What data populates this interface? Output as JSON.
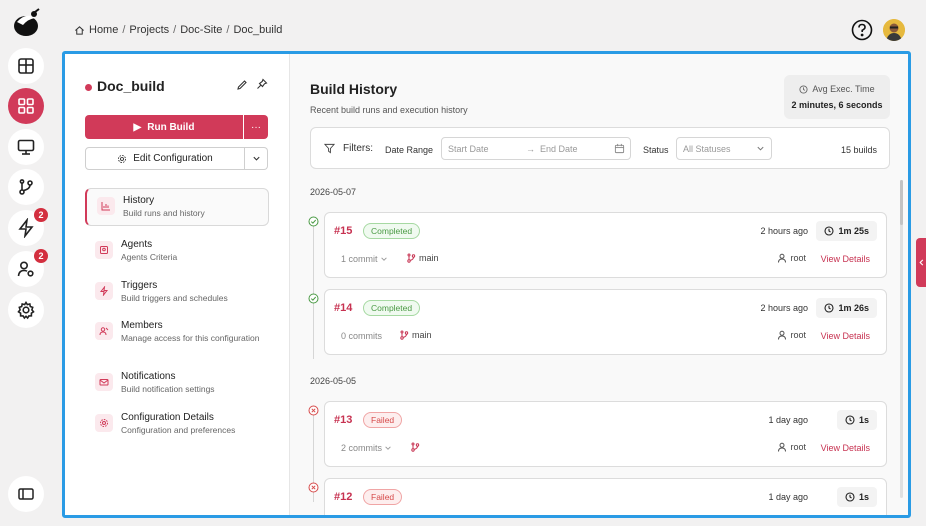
{
  "breadcrumb": {
    "items": [
      "Home",
      "Projects",
      "Doc-Site",
      "Doc_build"
    ],
    "sep": "/"
  },
  "rail": {
    "badges": {
      "builds": "2",
      "users": "2"
    }
  },
  "project": {
    "name": "Doc_build"
  },
  "actions": {
    "run_label": "Run Build",
    "more_label": "···",
    "edit_config_label": "Edit Configuration"
  },
  "nav": [
    {
      "title": "History",
      "sub": "Build runs and history"
    },
    {
      "title": "Agents",
      "sub": "Agents Criteria"
    },
    {
      "title": "Triggers",
      "sub": "Build triggers and schedules"
    },
    {
      "title": "Members",
      "sub": "Manage access for this configuration"
    },
    {
      "title": "Notifications",
      "sub": "Build notification settings"
    },
    {
      "title": "Configuration Details",
      "sub": "Configuration and preferences"
    }
  ],
  "history": {
    "title": "Build History",
    "subtitle": "Recent build runs and execution history",
    "avg_label": "Avg Exec. Time",
    "avg_value": "2 minutes, 6 seconds"
  },
  "filters": {
    "label": "Filters:",
    "date_range_label": "Date Range",
    "start_placeholder": "Start Date",
    "arrow": "→",
    "end_placeholder": "End Date",
    "status_label": "Status",
    "status_value": "All Statuses",
    "count": "15 builds"
  },
  "groups": [
    {
      "date": "2026-05-07"
    },
    {
      "date": "2026-05-05"
    }
  ],
  "builds": [
    {
      "num": "#15",
      "status": "Completed",
      "time": "2 hours ago",
      "duration": "1m 25s",
      "commits": "1 commit",
      "branch": "main",
      "user": "root",
      "details": "View Details"
    },
    {
      "num": "#14",
      "status": "Completed",
      "time": "2 hours ago",
      "duration": "1m 26s",
      "commits": "0 commits",
      "branch": "main",
      "user": "root",
      "details": "View Details"
    },
    {
      "num": "#13",
      "status": "Failed",
      "time": "1 day ago",
      "duration": "1s",
      "commits": "2 commits",
      "branch": "",
      "user": "root",
      "details": "View Details"
    },
    {
      "num": "#12",
      "status": "Failed",
      "time": "1 day ago",
      "duration": "1s"
    }
  ],
  "colors": {
    "accent": "#d13a59",
    "frame": "#2a9be5",
    "success": "#4a9a44",
    "failure": "#d64a4a"
  }
}
